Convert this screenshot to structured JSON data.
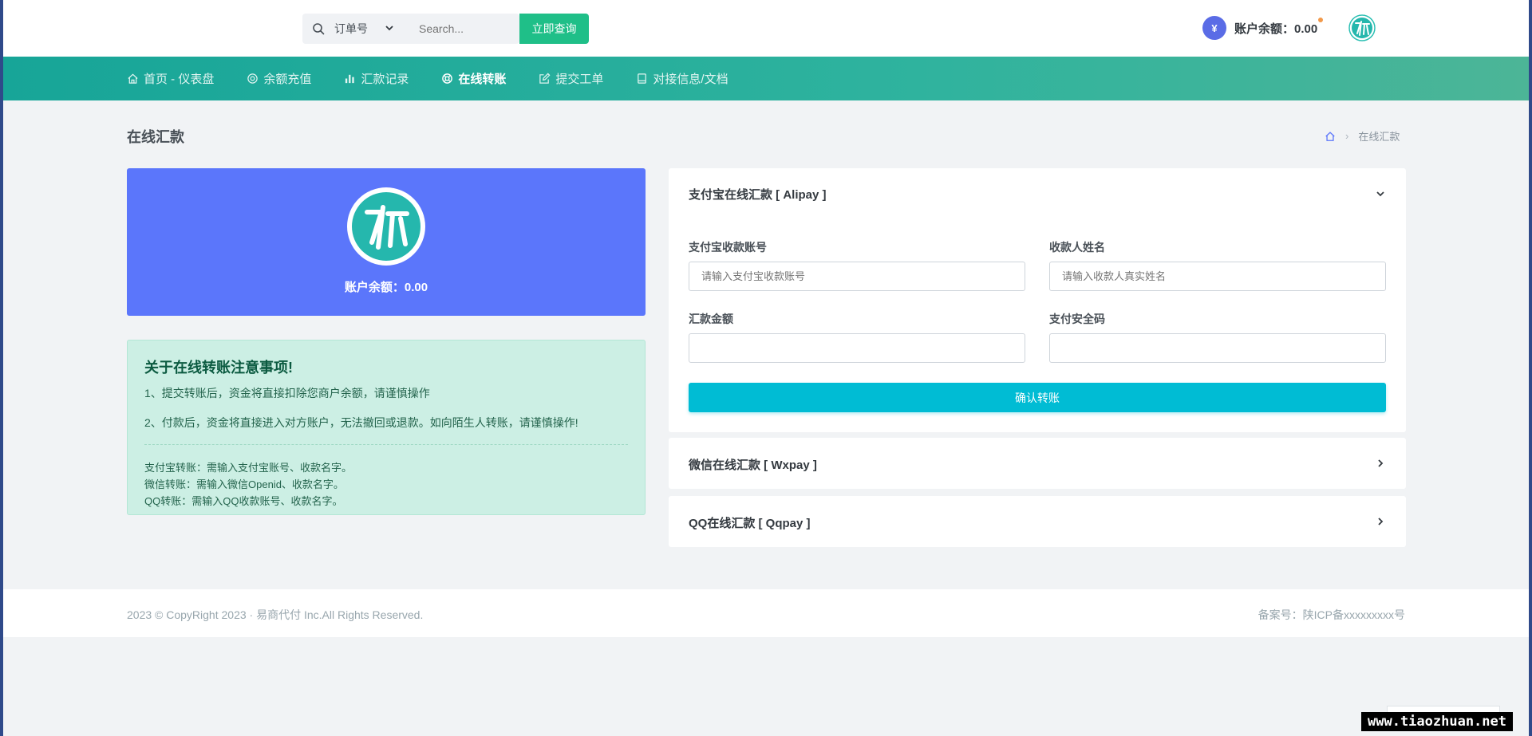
{
  "topbar": {
    "select_value": "订单号",
    "search_placeholder": "Search...",
    "search_button": "立即查询",
    "yen_symbol": "¥",
    "balance_label": "账户余额：0.00"
  },
  "nav": {
    "items": [
      {
        "label": "首页 - 仪表盘",
        "icon": "home-icon"
      },
      {
        "label": "余额充值",
        "icon": "coin-icon"
      },
      {
        "label": "汇款记录",
        "icon": "bar-chart-icon"
      },
      {
        "label": "在线转账",
        "icon": "lifebuoy-icon"
      },
      {
        "label": "提交工单",
        "icon": "edit-icon"
      },
      {
        "label": "对接信息/文档",
        "icon": "book-icon"
      }
    ]
  },
  "page": {
    "title": "在线汇款",
    "breadcrumb_current": "在线汇款"
  },
  "profile": {
    "balance": "账户余额：0.00"
  },
  "notice": {
    "title": "关于在线转账注意事项!",
    "p1": "1、提交转账后，资金将直接扣除您商户余额，请谨慎操作",
    "p2": "2、付款后，资金将直接进入对方账户，无法撤回或退款。如向陌生人转账，请谨慎操作!",
    "lines": [
      "支付宝转账：需输入支付宝账号、收款名字。",
      "微信转账：需输入微信Openid、收款名字。",
      "QQ转账：需输入QQ收款账号、收款名字。"
    ]
  },
  "alipay": {
    "header": "支付宝在线汇款 [ Alipay ]",
    "account_label": "支付宝收款账号",
    "account_placeholder": "请输入支付宝收款账号",
    "name_label": "收款人姓名",
    "name_placeholder": "请输入收款人真实姓名",
    "amount_label": "汇款金额",
    "code_label": "支付安全码",
    "submit": "确认转账"
  },
  "wxpay": {
    "header": "微信在线汇款 [ Wxpay ]"
  },
  "qqpay": {
    "header": "QQ在线汇款 [ Qqpay ]"
  },
  "footer": {
    "copyright": "2023 © CopyRight 2023 · 易商代付 Inc.All Rights Reserved.",
    "icp": "备案号：陕ICP备xxxxxxxxx号"
  },
  "watermark": "www.tiaozhuan.net",
  "colors": {
    "accent_green": "#1fbf88",
    "nav_teal": "#17a598",
    "profile_blue": "#5b76fb",
    "submit_cyan": "#00bcd4"
  }
}
